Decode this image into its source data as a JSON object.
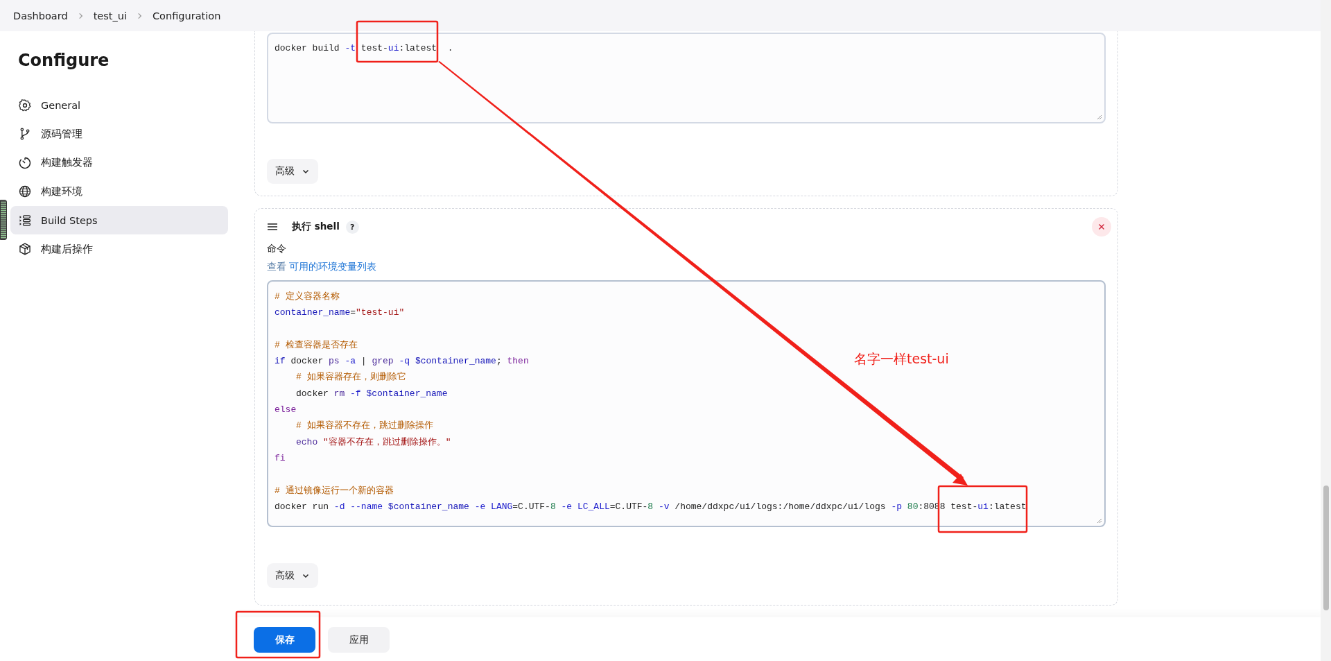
{
  "breadcrumb": [
    "Dashboard",
    "test_ui",
    "Configuration"
  ],
  "sidebar": {
    "title": "Configure",
    "items": [
      {
        "label": "General",
        "selected": false
      },
      {
        "label": "源码管理",
        "selected": false
      },
      {
        "label": "构建触发器",
        "selected": false
      },
      {
        "label": "构建环境",
        "selected": false
      },
      {
        "label": "Build Steps",
        "selected": true
      },
      {
        "label": "构建后操作",
        "selected": false
      }
    ]
  },
  "docker_step": {
    "lines": [
      {
        "indented": false,
        "blank_before": false,
        "tokens": [
          {
            "kind": "plain",
            "text": "docker build "
          },
          {
            "kind": "option",
            "text": "-t"
          },
          {
            "kind": "plain",
            "text": " test-"
          },
          {
            "kind": "option",
            "text": "ui"
          },
          {
            "kind": "plain",
            "text": ":latest  ."
          }
        ]
      }
    ],
    "advanced": "高级"
  },
  "shell_step": {
    "title": "执行 shell",
    "help": "?",
    "field_label": "命令",
    "hint_prefix": "查看",
    "hint_link": "可用的环境变量列表",
    "lines": [
      {
        "indented": false,
        "blank_before": false,
        "tokens": [
          {
            "kind": "comment",
            "text": "# 定义容器名称"
          }
        ]
      },
      {
        "indented": false,
        "blank_before": false,
        "tokens": [
          {
            "kind": "variable",
            "text": "container_name"
          },
          {
            "kind": "plain",
            "text": "="
          },
          {
            "kind": "string",
            "text": "\"test-ui\""
          }
        ]
      },
      {
        "indented": false,
        "blank_before": true,
        "tokens": [
          {
            "kind": "comment",
            "text": "# 检查容器是否存在"
          }
        ]
      },
      {
        "indented": false,
        "blank_before": false,
        "tokens": [
          {
            "kind": "variable",
            "text": "if"
          },
          {
            "kind": "plain",
            "text": " docker "
          },
          {
            "kind": "builtin",
            "text": "ps "
          },
          {
            "kind": "option",
            "text": "-a"
          },
          {
            "kind": "plain",
            "text": " | "
          },
          {
            "kind": "builtin",
            "text": "grep "
          },
          {
            "kind": "option",
            "text": "-q "
          },
          {
            "kind": "variable",
            "text": "$container_name"
          },
          {
            "kind": "plain",
            "text": "; "
          },
          {
            "kind": "keyword",
            "text": "then"
          }
        ]
      },
      {
        "indented": true,
        "blank_before": false,
        "tokens": [
          {
            "kind": "comment",
            "text": "# 如果容器存在，则删除它"
          }
        ]
      },
      {
        "indented": true,
        "blank_before": false,
        "tokens": [
          {
            "kind": "plain",
            "text": "docker "
          },
          {
            "kind": "builtin",
            "text": "rm "
          },
          {
            "kind": "option",
            "text": "-f "
          },
          {
            "kind": "variable",
            "text": "$container_name"
          }
        ]
      },
      {
        "indented": false,
        "blank_before": false,
        "tokens": [
          {
            "kind": "keyword",
            "text": "else"
          }
        ]
      },
      {
        "indented": true,
        "blank_before": false,
        "tokens": [
          {
            "kind": "comment",
            "text": "# 如果容器不存在，跳过删除操作"
          }
        ]
      },
      {
        "indented": true,
        "blank_before": false,
        "tokens": [
          {
            "kind": "builtin",
            "text": "echo "
          },
          {
            "kind": "string",
            "text": "\"容器不存在，跳过删除操作。\""
          }
        ]
      },
      {
        "indented": false,
        "blank_before": false,
        "tokens": [
          {
            "kind": "keyword",
            "text": "fi"
          }
        ]
      },
      {
        "indented": false,
        "blank_before": true,
        "tokens": [
          {
            "kind": "comment",
            "text": "# 通过镜像运行一个新的容器"
          }
        ]
      },
      {
        "indented": false,
        "blank_before": false,
        "tokens": [
          {
            "kind": "plain",
            "text": "docker run "
          },
          {
            "kind": "option",
            "text": "-d --name "
          },
          {
            "kind": "variable",
            "text": "$container_name"
          },
          {
            "kind": "option",
            "text": " -e LANG"
          },
          {
            "kind": "plain",
            "text": "=C.UTF-"
          },
          {
            "kind": "number",
            "text": "8"
          },
          {
            "kind": "option",
            "text": " -e LC_ALL"
          },
          {
            "kind": "plain",
            "text": "=C.UTF-"
          },
          {
            "kind": "number",
            "text": "8"
          },
          {
            "kind": "option",
            "text": " -v"
          },
          {
            "kind": "plain",
            "text": " /home/ddxpc/ui/logs:/home/ddxpc/ui/logs "
          },
          {
            "kind": "option",
            "text": "-p "
          },
          {
            "kind": "number",
            "text": "80"
          },
          {
            "kind": "plain",
            "text": ":8088 test-"
          },
          {
            "kind": "option",
            "text": "ui"
          },
          {
            "kind": "plain",
            "text": ":latest"
          }
        ]
      }
    ],
    "advanced": "高级"
  },
  "buttons": [
    "保存",
    "应用"
  ],
  "annotation": {
    "note": "名字一样test-ui"
  }
}
